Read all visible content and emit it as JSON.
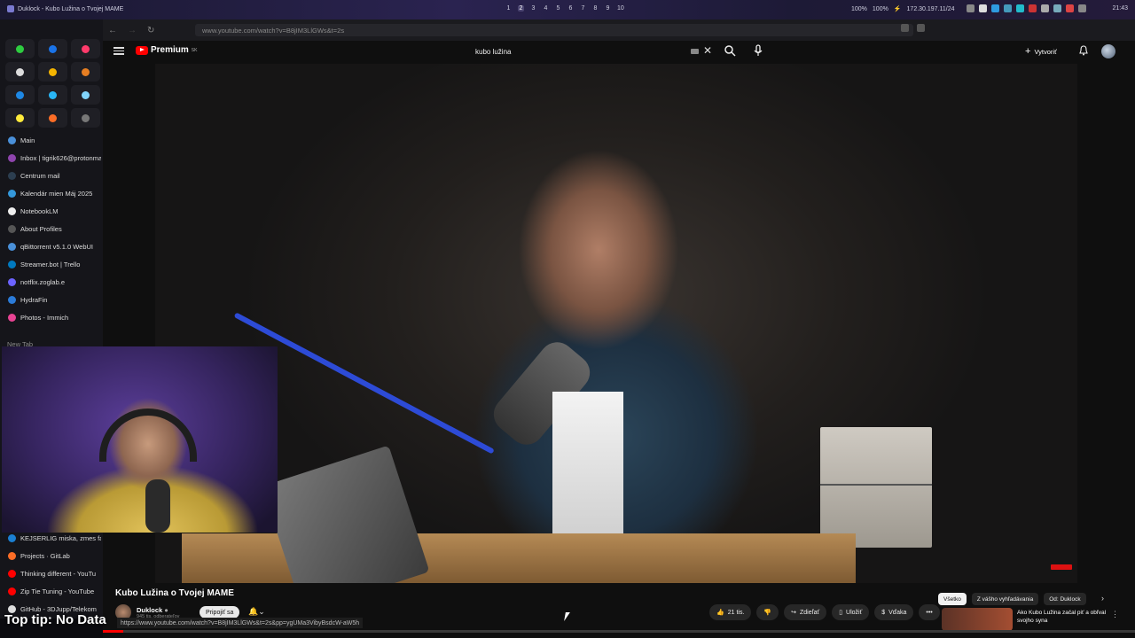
{
  "system": {
    "window_title": "Duklock - Kubo Lužina o Tvojej MAME",
    "workspaces": [
      "1",
      "2",
      "3",
      "4",
      "5",
      "6",
      "7",
      "8",
      "9",
      "10"
    ],
    "active_workspace": "2",
    "battery1": "100%",
    "battery2": "100%",
    "ip": "172.30.197.11/24",
    "clock": "21:43"
  },
  "browser": {
    "url": "www.youtube.com/watch?v=B8jIM3LlGWs&t=2s",
    "pinned_colors": [
      "#2ecc40",
      "#1a73e8",
      "#ff3b6b",
      "#dddddd",
      "#f4b400",
      "#e67e22",
      "#1e88e5",
      "#29b6f6",
      "#81d4fa",
      "#ffeb3b",
      "#fc6d26",
      "#777777"
    ],
    "tabs": [
      {
        "label": "Main",
        "color": "#4a90d9"
      },
      {
        "label": "Inbox | tigrik626@protonmail",
        "color": "#8e44ad"
      },
      {
        "label": "Centrum mail",
        "color": "#2c3e50"
      },
      {
        "label": "Kalendár mien Máj 2025",
        "color": "#3498db"
      },
      {
        "label": "NotebookLM",
        "color": "#eeeeee"
      },
      {
        "label": "About Profiles",
        "color": "#555555"
      },
      {
        "label": "qBittorrent v5.1.0 WebUI",
        "color": "#4a90d9"
      },
      {
        "label": "Streamer.bot | Trello",
        "color": "#0079bf"
      },
      {
        "label": "notflix.zoglab.e",
        "color": "#6c63ff"
      },
      {
        "label": "HydraFin",
        "color": "#2b7bd8"
      },
      {
        "label": "Photos - Immich",
        "color": "#e84393"
      }
    ],
    "new_tab": "New Tab",
    "tabs_bottom": [
      {
        "label": "KEJSERLIG miska, zmes fa",
        "color": "#1b7fd1"
      },
      {
        "label": "Projects · GitLab",
        "color": "#fc6d26"
      },
      {
        "label": "Thinking different - YouTu",
        "color": "#ff0000"
      },
      {
        "label": "Zip Tie Tuning - YouTube",
        "color": "#ff0000"
      },
      {
        "label": "GitHub - 3DJupp/Telekom",
        "color": "#dddddd"
      }
    ]
  },
  "youtube": {
    "logo": "Premium",
    "logo_region": "SK",
    "search_value": "kubo lužina",
    "create_label": "Vytvoriť",
    "video_title": "Kubo Lužina o Tvojej MAME",
    "channel_name": "Duklock",
    "subscribers": "945 tis. odberateľov",
    "join_label": "Pripojiť sa",
    "likes": "21 tis.",
    "share_label": "Zdieľať",
    "save_label": "Uložiť",
    "thanks_label": "Vďaka",
    "chips": [
      "Všetko",
      "Z vášho vyhľadávania",
      "Od: Duklock"
    ],
    "rec_title": "Ako Kubo Lužina začal piť a obľval svojho syna",
    "progress": 0.02
  },
  "status_url": "https://www.youtube.com/watch?v=B8jIM3LlGWs&t=2s&pp=ygUMa3VibyBsdcW-aW5h",
  "overlay_tip": "Top tip: No Data"
}
